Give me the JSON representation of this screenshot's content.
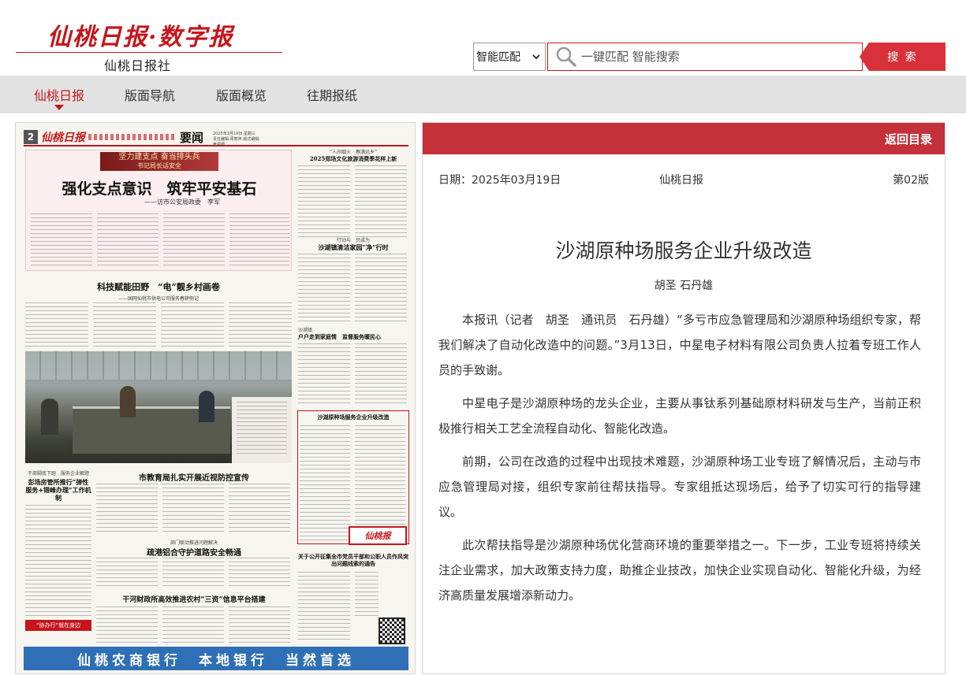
{
  "site": {
    "logo_main": "仙桃日报·数字报",
    "logo_sub": "仙桃日报社"
  },
  "search": {
    "mode_selected": "智能匹配",
    "placeholder": "一键匹配 智能搜索",
    "button_label": "搜 索"
  },
  "nav": {
    "items": [
      {
        "label": "仙桃日报",
        "active": true
      },
      {
        "label": "版面导航",
        "active": false
      },
      {
        "label": "版面概览",
        "active": false
      },
      {
        "label": "往期报纸",
        "active": false
      }
    ]
  },
  "newspaper_page": {
    "page_number": "2",
    "paper_logo": "仙桃日报",
    "section": "要闻",
    "date_line": "2025年3月19日 星期三 责任编辑:周丽萍 版式编辑:黄振卿",
    "banner_slogan": "坚力建支点  奋当排头兵",
    "banner_sub": "书记局长话安全",
    "headline_main": "强化支点意识　筑牢平安基石",
    "headline_main_sub": "——访市公安局政委　李军",
    "headline_2": "科技赋能田野　“电”靓乡村画卷",
    "headline_2_sub": "——国网仙桃市供电公司服务春耕侧记",
    "right_head_1_kicker": "“人间烟火　春满远乡”",
    "right_head_1": "2025郑场文化旅游消费季花样上新",
    "right_head_2_kicker": "行动与　只成为",
    "right_head_2": "沙湖镇清洁家园“净”行时",
    "right_head_3_kicker": "沙湖镇",
    "right_head_3": "户户走到家庭情　监督服务暖民心",
    "right_head_4": "沙湖原种场服务企业升级改造",
    "left_head_3_kicker": "干部脚底下跑　服务企业解题",
    "left_head_3": "彭场房管所推行“弹性服务+错峰办理”工作机制",
    "center_head_1": "市教育局扎实开展近视防控宣传",
    "center_head_2_kicker": "部门联动推进问题解决",
    "center_head_2": "疏港铝合守护道路安全畅通",
    "center_head_3": "干河财政所高效推进农村“三资”信息平台搭建",
    "right_head_5": "关于公开征集全市党员干部和公职人员作风突出问题线索的通告",
    "stamp_text": "仙桃报",
    "slogan_red": "“协办行”就在身边",
    "ad_text": "仙桃农商银行　本地银行　当然首选"
  },
  "article": {
    "back_label": "返回目录",
    "date": "日期：2025年03月19日",
    "paper": "仙桃日报",
    "page": "第02版",
    "title": "沙湖原种场服务企业升级改造",
    "author": "胡圣 石丹雄",
    "paragraphs": [
      "本报讯（记者　胡圣　通讯员　石丹雄）“多亏市应急管理局和沙湖原种场组织专家，帮我们解决了自动化改造中的问题。”3月13日，中星电子材料有限公司负责人拉着专班工作人员的手致谢。",
      "中星电子是沙湖原种场的龙头企业，主要从事钛系列基础原材料研发与生产，当前正积极推行相关工艺全流程自动化、智能化改造。",
      "前期，公司在改造的过程中出现技术难题，沙湖原种场工业专班了解情况后，主动与市应急管理局对接，组织专家前往帮扶指导。专家组抵达现场后，给予了切实可行的指导建议。",
      "此次帮扶指导是沙湖原种场优化营商环境的重要举措之一。下一步，工业专班将持续关注企业需求，加大政策支持力度，助推企业技改，加快企业实现自动化、智能化升级，为经济高质量发展增添新动力。"
    ]
  },
  "colors": {
    "brand_red": "#c4161c",
    "panel_bar": "#c4313a",
    "search_button": "#d8313a",
    "nav_bg": "#e2e2e2",
    "ad_blue": "#2f6fb5"
  },
  "icons": {
    "search": "search-icon",
    "select_arrow": "chevron-down-icon",
    "nav_active": "caret-down-icon"
  }
}
